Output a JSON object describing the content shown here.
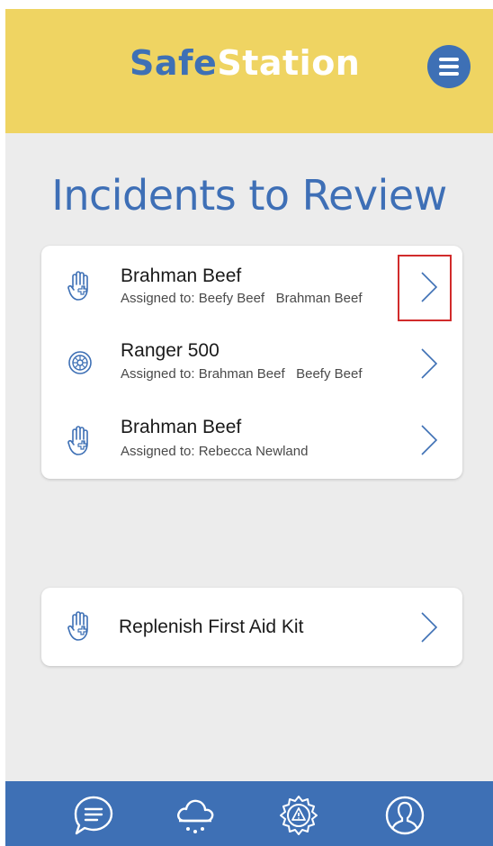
{
  "header": {
    "logo_part1": "Safe",
    "logo_part2": "Station",
    "menu_icon": "hamburger-menu-icon",
    "bg_color": "#efd462",
    "accent_color": "#3e70b5"
  },
  "page_title": "Incidents to Review",
  "incidents": [
    {
      "name": "Brahman Beef",
      "assigned": "Assigned to: Beefy Beef   Brahman Beef",
      "icon": "first-aid-hand-icon"
    },
    {
      "name": "Ranger 500",
      "assigned": "Assigned to: Brahman Beef   Beefy Beef",
      "icon": "wheel-icon"
    },
    {
      "name": "Brahman Beef",
      "assigned": "Assigned to: Rebecca Newland",
      "icon": "first-aid-hand-icon"
    }
  ],
  "task": {
    "name": "Replenish First Aid Kit",
    "icon": "first-aid-hand-icon"
  },
  "bottom_nav": {
    "items": [
      "chat-icon",
      "weather-icon",
      "settings-hazard-icon",
      "profile-icon"
    ]
  }
}
